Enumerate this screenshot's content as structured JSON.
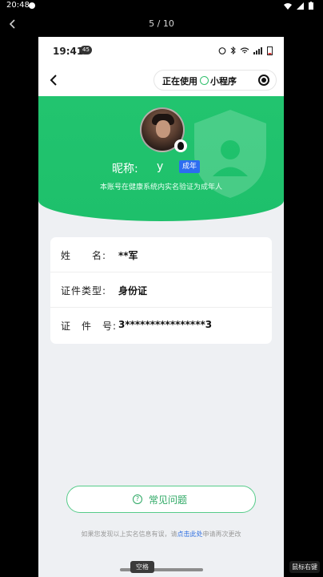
{
  "outer_status": {
    "time": "20:48"
  },
  "viewer": {
    "counter": "5 / 10"
  },
  "phone": {
    "status": {
      "time": "19:41",
      "badge": "45"
    },
    "capsule": {
      "text_a": "正在使用",
      "text_b": "小程序"
    },
    "hero": {
      "nickname_label": "昵称:",
      "nickname_value": "y",
      "adult_badge": "成年",
      "verify_text": "本账号在健康系统内实名验证为成年人"
    },
    "info": [
      {
        "label": "姓　　名:",
        "value": "**军"
      },
      {
        "label": "证件类型:",
        "value": "身份证"
      },
      {
        "label": "证　件　号:",
        "value": "3****************3"
      }
    ],
    "faq": {
      "label": "常见问题",
      "icon": "question-icon"
    },
    "footer": {
      "prefix": "如果您发现以上实名信息有误，请",
      "link": "点击此处",
      "suffix": "申请再次更改"
    }
  },
  "overlay": {
    "space_key": "空格",
    "right_click": "鼠标右键"
  },
  "colors": {
    "primary_green": "#22c46f",
    "badge_blue": "#2c6df0",
    "link_blue": "#2f6fe0"
  }
}
